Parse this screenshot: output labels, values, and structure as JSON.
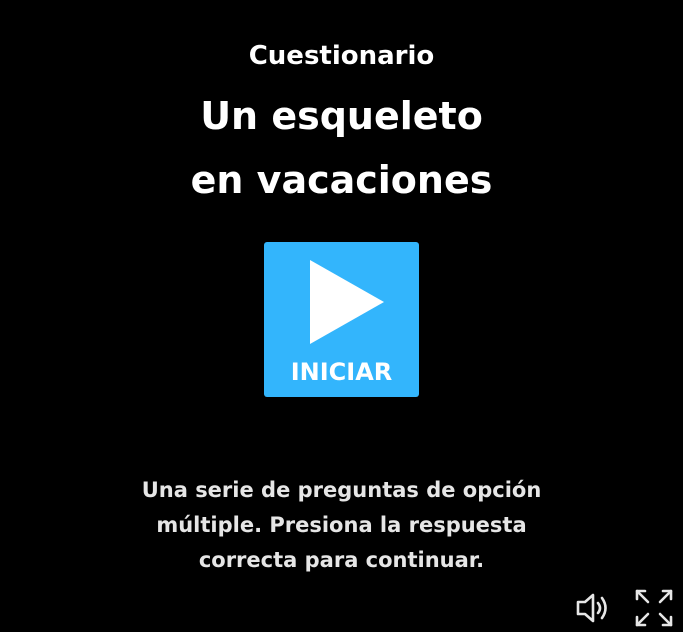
{
  "header": {
    "eyebrow": "Cuestionario",
    "title_line_1": "Un esqueleto",
    "title_line_2": "en vacaciones"
  },
  "start_button": {
    "label": "INICIAR",
    "icon": "play-icon",
    "color": "#33b5fc"
  },
  "description": {
    "line_1": "Una serie de preguntas de opción",
    "line_2": "múltiple. Presiona la respuesta",
    "line_3": "correcta para continuar."
  },
  "controls": {
    "sound_icon": "speaker-icon",
    "fullscreen_icon": "fullscreen-icon"
  },
  "colors": {
    "background": "#000000",
    "text": "#ffffff",
    "accent": "#33b5fc"
  }
}
